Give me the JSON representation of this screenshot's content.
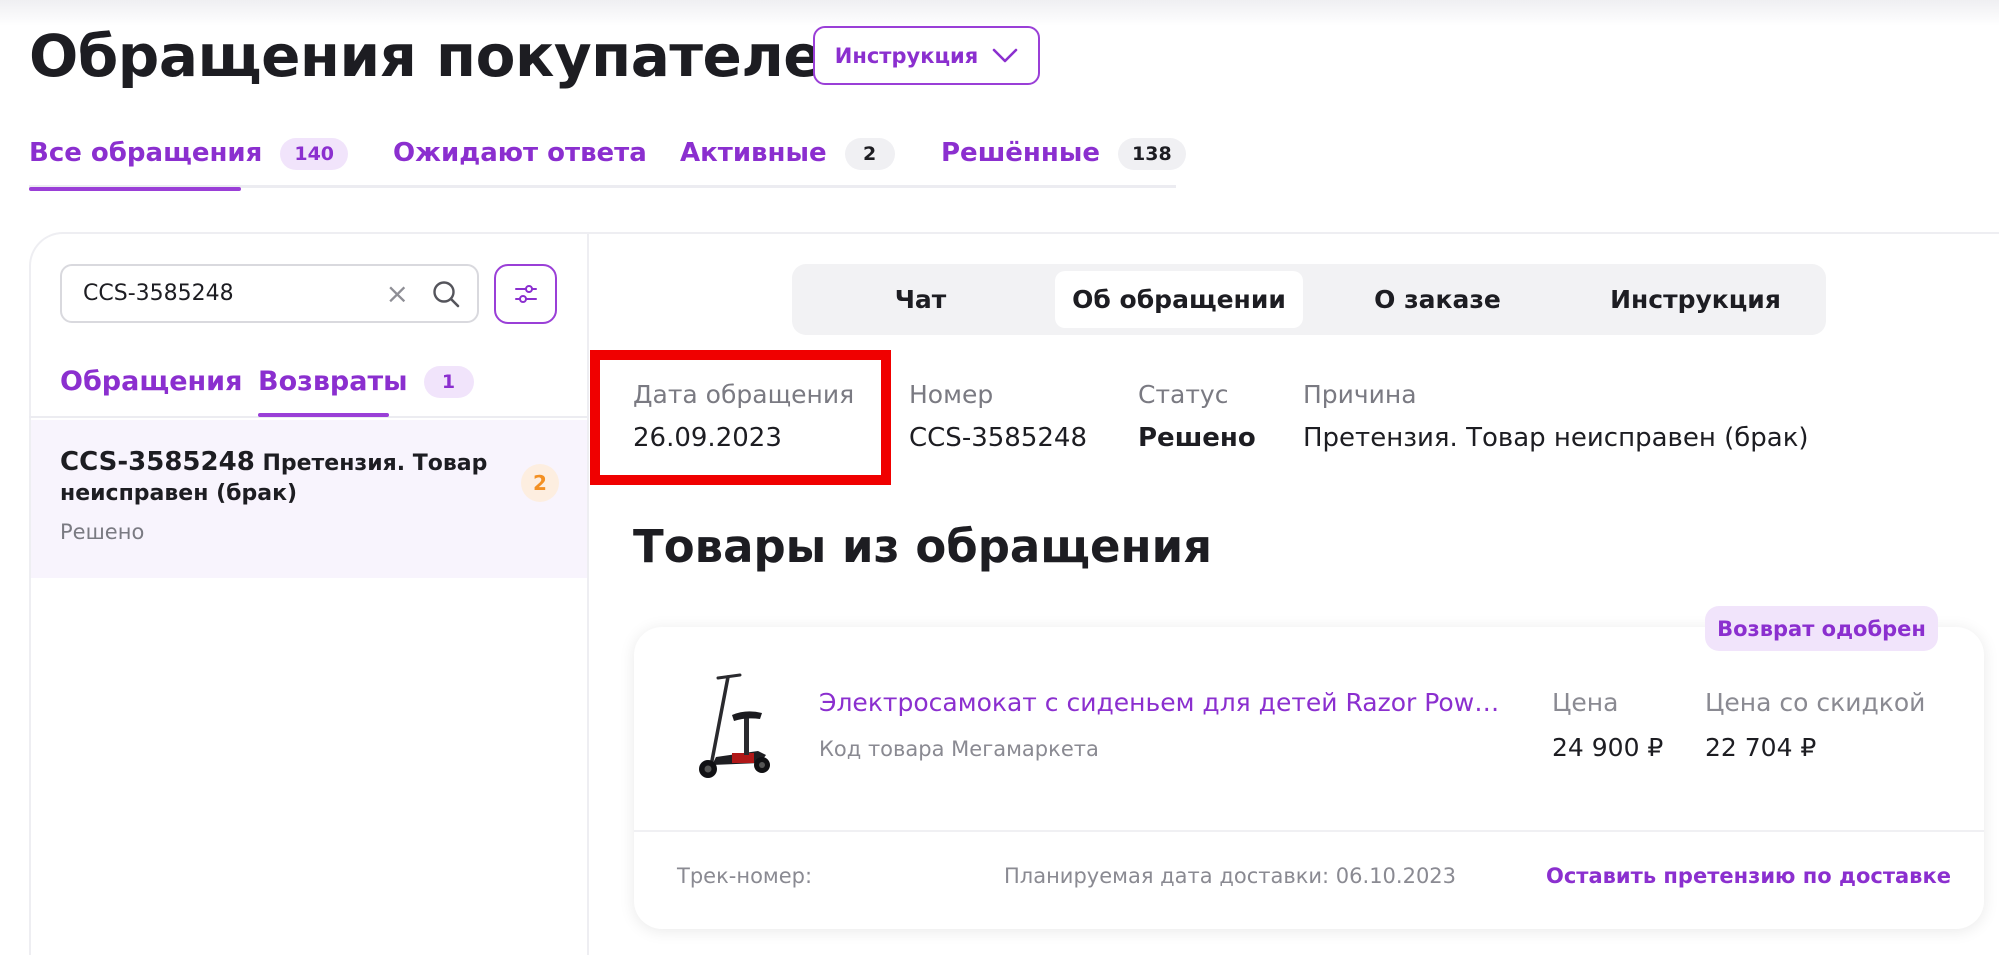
{
  "header": {
    "title": "Обращения покупателей",
    "instruction_btn": "Инструкция",
    "instruction_icon": "chevron-down-icon"
  },
  "main_tabs": [
    {
      "label": "Все обращения",
      "count": "140"
    },
    {
      "label": "Ожидают ответа"
    },
    {
      "label": "Активные",
      "count": "2"
    },
    {
      "label": "Решённые",
      "count": "138"
    }
  ],
  "sidebar": {
    "search": {
      "value": "CCS-3585248",
      "clear_icon": "close-icon",
      "search_icon": "search-icon"
    },
    "filter_icon": "sliders-icon",
    "tabs": [
      {
        "label": "Обращения"
      },
      {
        "label": "Возвраты",
        "count": "1"
      }
    ],
    "item": {
      "number": "CCS-3585248",
      "title": "Претензия. Товар неисправен (брак)",
      "status": "Решено",
      "badge": "2"
    }
  },
  "detail": {
    "segments": [
      "Чат",
      "Об обращении",
      "О заказе",
      "Инструкция"
    ],
    "info": {
      "date_label": "Дата обращения",
      "date_value": "26.09.2023",
      "number_label": "Номер",
      "number_value": "CCS-3585248",
      "status_label": "Статус",
      "status_value": "Решено",
      "reason_label": "Причина",
      "reason_value": "Претензия. Товар неисправен (брак)"
    },
    "products_title": "Товары из обращения",
    "product": {
      "badge": "Возврат одобрен",
      "name": "Электросамокат с сиденьем для детей Razor Powe...",
      "code_label": "Код товара Мегамаркета",
      "price_label": "Цена",
      "price_value": "24 900 ₽",
      "discount_label": "Цена со скидкой",
      "discount_value": "22 704 ₽",
      "track_label": "Трек-номер:",
      "delivery_date": "Планируемая дата доставки: 06.10.2023",
      "claim_link": "Оставить претензию по доставке"
    }
  },
  "colors": {
    "accent": "#8b2fcf",
    "highlight": "#f00000",
    "badge_orange": "#f39023"
  }
}
